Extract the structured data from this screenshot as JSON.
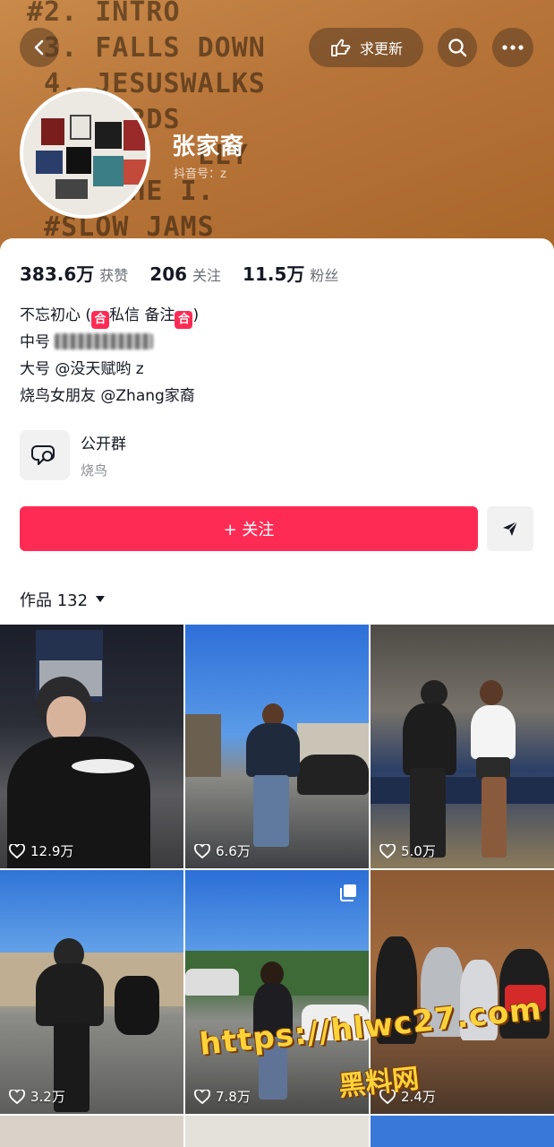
{
  "header": {
    "banner_text": "#2. INTRO\n 3. FALLS DOWN\n 4. JESUSWALKS\n     ORDS\n          LLY\n    ATHE I.\n #SLOW JAMS",
    "request_update_label": "求更新",
    "profile_name": "张家裔",
    "douyin_id_label": "抖音号：z"
  },
  "stats": {
    "likes_value": "383.6万",
    "likes_label": "获赞",
    "following_value": "206",
    "following_label": "关注",
    "followers_value": "11.5万",
    "followers_label": "粉丝"
  },
  "bio": {
    "line1_pre": "不忘初心 (",
    "line1_badge1": "合",
    "line1_mid": "私信 备注",
    "line1_badge2": "合",
    "line1_post": ")",
    "line2_pre": "中号 ",
    "line3": "大号 @没天赋哟 z",
    "line4": "烧鸟女朋友 @Zhang家裔"
  },
  "group": {
    "title": "公开群",
    "subtitle": "烧鸟"
  },
  "actions": {
    "follow_label": "+ 关注"
  },
  "works": {
    "label": "作品 132"
  },
  "videos": [
    {
      "likes": "12.9万"
    },
    {
      "likes": "6.6万"
    },
    {
      "likes": "5.0万"
    },
    {
      "likes": "3.2万"
    },
    {
      "likes": "7.8万"
    },
    {
      "likes": "2.4万"
    }
  ],
  "watermark": {
    "url": "https://hlwc27.com",
    "site": "黑料网"
  },
  "colors": {
    "accent": "#fe2c55",
    "banner": "#b8753a"
  },
  "icons": [
    "back-icon",
    "hand-pointer-icon",
    "search-icon",
    "more-icon",
    "chat-bubble-icon",
    "send-icon",
    "caret-down-icon",
    "heart-icon",
    "multi-image-icon"
  ]
}
